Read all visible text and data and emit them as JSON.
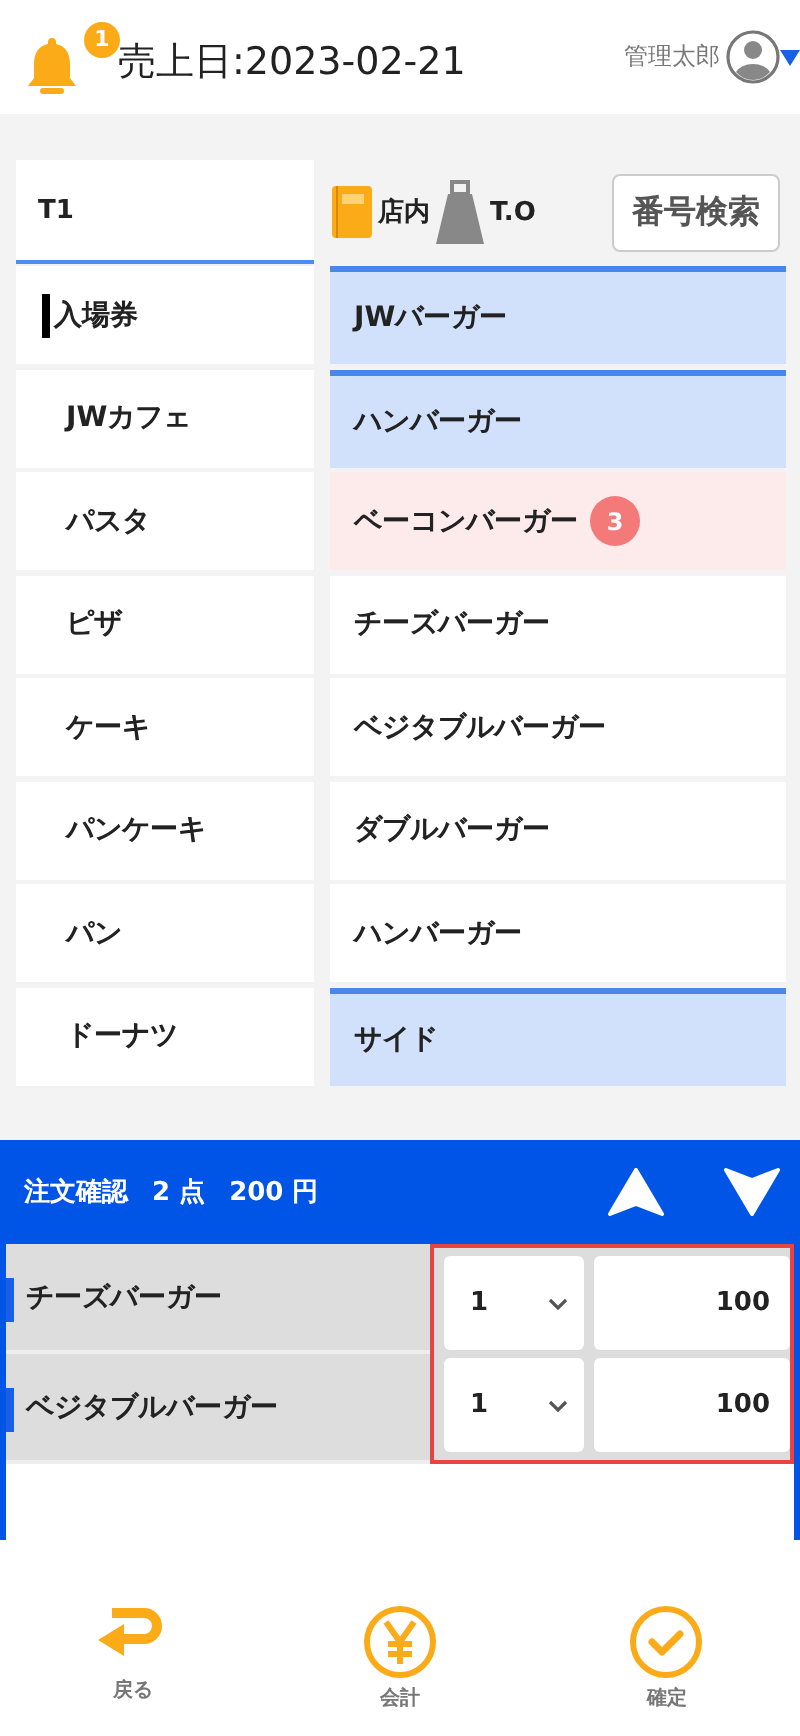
{
  "header": {
    "notification_count": "1",
    "sales_date": "売上日:2023-02-21",
    "user_name": "管理太郎"
  },
  "table_tab": {
    "label": "T1",
    "selected": true
  },
  "service_options": [
    {
      "kind": "dine_in",
      "label": "店内"
    },
    {
      "kind": "takeout",
      "label": "T.O"
    }
  ],
  "search_button": "番号検索",
  "categories": [
    {
      "label": "入場券",
      "selected": true
    },
    {
      "label": "JWカフェ",
      "selected": false
    },
    {
      "label": "パスタ",
      "selected": false
    },
    {
      "label": "ピザ",
      "selected": false
    },
    {
      "label": "ケーキ",
      "selected": false
    },
    {
      "label": "パンケーキ",
      "selected": false
    },
    {
      "label": "パン",
      "selected": false
    },
    {
      "label": "ドーナツ",
      "selected": false
    }
  ],
  "menu_items": [
    {
      "kind": "group",
      "label": "JWバーガー"
    },
    {
      "kind": "group",
      "label": "ハンバーガー"
    },
    {
      "kind": "product",
      "label": "ベーコンバーガー",
      "count": "3"
    },
    {
      "kind": "product",
      "label": "チーズバーガー"
    },
    {
      "kind": "product",
      "label": "ベジタブルバーガー"
    },
    {
      "kind": "product",
      "label": "ダブルバーガー"
    },
    {
      "kind": "product",
      "label": "ハンバーガー"
    },
    {
      "kind": "group",
      "label": "サイド"
    }
  ],
  "order": {
    "title": "注文確認",
    "count": "2 点",
    "total": "200 円",
    "lines": [
      {
        "name": "チーズバーガー",
        "quantity": "1",
        "price": "100"
      },
      {
        "name": "ベジタブルバーガー",
        "quantity": "1",
        "price": "100"
      }
    ]
  },
  "footer": [
    {
      "kind": "back",
      "label": "戻る"
    },
    {
      "kind": "checkout",
      "label": "会計"
    },
    {
      "kind": "confirm",
      "label": "確定"
    }
  ]
}
